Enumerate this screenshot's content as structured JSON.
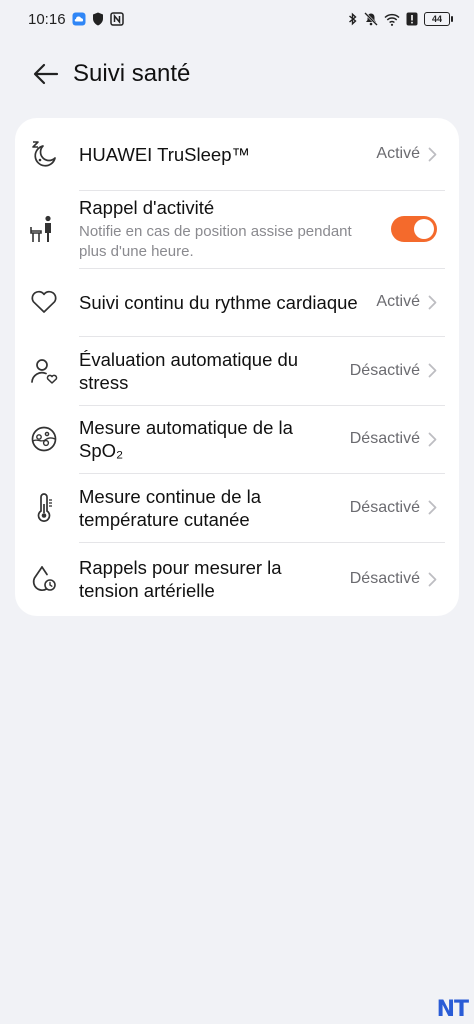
{
  "status_bar": {
    "time": "10:16",
    "battery": "44"
  },
  "header": {
    "title": "Suivi santé"
  },
  "settings": [
    {
      "title": "HUAWEI TruSleep™",
      "status": "Activé",
      "icon": "sleep-icon"
    },
    {
      "title": "Rappel d'activité",
      "subtitle": "Notifie en cas de position assise pendant plus d'une heure.",
      "toggle_on": true,
      "icon": "person-sitting-icon"
    },
    {
      "title": "Suivi continu du rythme cardiaque",
      "status": "Activé",
      "icon": "heart-icon"
    },
    {
      "title": "Évaluation automatique du stress",
      "status": "Désactivé",
      "icon": "stress-person-icon"
    },
    {
      "title": "Mesure automatique de la SpO₂",
      "status": "Désactivé",
      "icon": "spo2-icon"
    },
    {
      "title": "Mesure continue de la température cutanée",
      "status": "Désactivé",
      "icon": "thermometer-icon"
    },
    {
      "title": "Rappels pour mesurer la tension artérielle",
      "status": "Désactivé",
      "icon": "blood-pressure-icon"
    }
  ],
  "watermark": "NT",
  "colors": {
    "accent": "#f46a2c",
    "background": "#f1f2f6",
    "card": "#ffffff"
  }
}
